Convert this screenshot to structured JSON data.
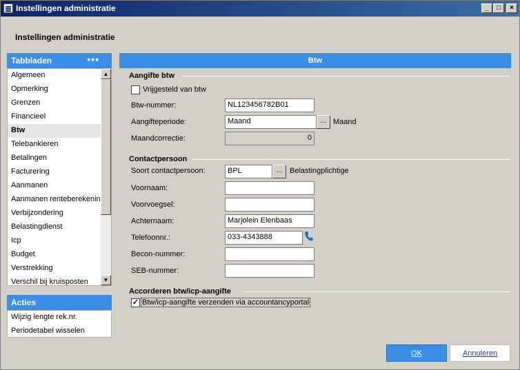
{
  "window": {
    "title": "Instellingen administratie"
  },
  "page_title": "Instellingen administratie",
  "sidebar": {
    "tabs_header": "Tabbladen",
    "tabs_more": "•••",
    "tabs": [
      "Algemeen",
      "Opmerking",
      "Grenzen",
      "Financieel",
      "Btw",
      "Telebankieren",
      "Betalingen",
      "Facturering",
      "Aanmanen",
      "Aanmanen renteberekening",
      "Verbijzondering",
      "Belastingdienst",
      "Icp",
      "Budget",
      "Verstrekking",
      "Verschil bij kruisposten"
    ],
    "active_tab": "Btw",
    "actions_header": "Acties",
    "actions": [
      "Wijzig lengte rek.nr.",
      "Periodetabel wisselen"
    ]
  },
  "main": {
    "header": "Btw",
    "aangifte": {
      "title": "Aangifte btw",
      "vrijgesteld_label": "Vrijgesteld van btw",
      "vrijgesteld_checked": false,
      "btw_nummer_label": "Btw-nummer:",
      "btw_nummer": "NL123456782B01",
      "periode_label": "Aangifteperiode:",
      "periode": "Maand",
      "periode_aside": "Maand",
      "correctie_label": "Maandcorrectie:",
      "correctie": "0"
    },
    "contact": {
      "title": "Contactpersoon",
      "soort_label": "Soort contactpersoon:",
      "soort": "BPL",
      "soort_aside": "Belastingplichtige",
      "voornaam_label": "Voornaam:",
      "voornaam": "",
      "voorvoegsel_label": "Voorvoegsel:",
      "voorvoegsel": "",
      "achternaam_label": "Achternaam:",
      "achternaam": "Marjolein Elenbaas",
      "telefoon_label": "Telefoonnr.:",
      "telefoon": "033-4343888",
      "becon_label": "Becon-nummer:",
      "becon": "",
      "seb_label": "SEB-nummer:",
      "seb": ""
    },
    "accorderen": {
      "title": "Accorderen btw/icp-aangifte",
      "portal_label": "Btw/icp-aangifte verzenden via accountancyportal",
      "portal_checked": true
    }
  },
  "buttons": {
    "ok": "OK",
    "cancel": "Annuleren"
  },
  "icons": {
    "ellipsis": "...",
    "check": "✓"
  },
  "colors": {
    "accent": "#3a8ee6",
    "title_bar": "#0a246a",
    "face": "#d4d0c8",
    "phone": "#1e6fd0"
  }
}
